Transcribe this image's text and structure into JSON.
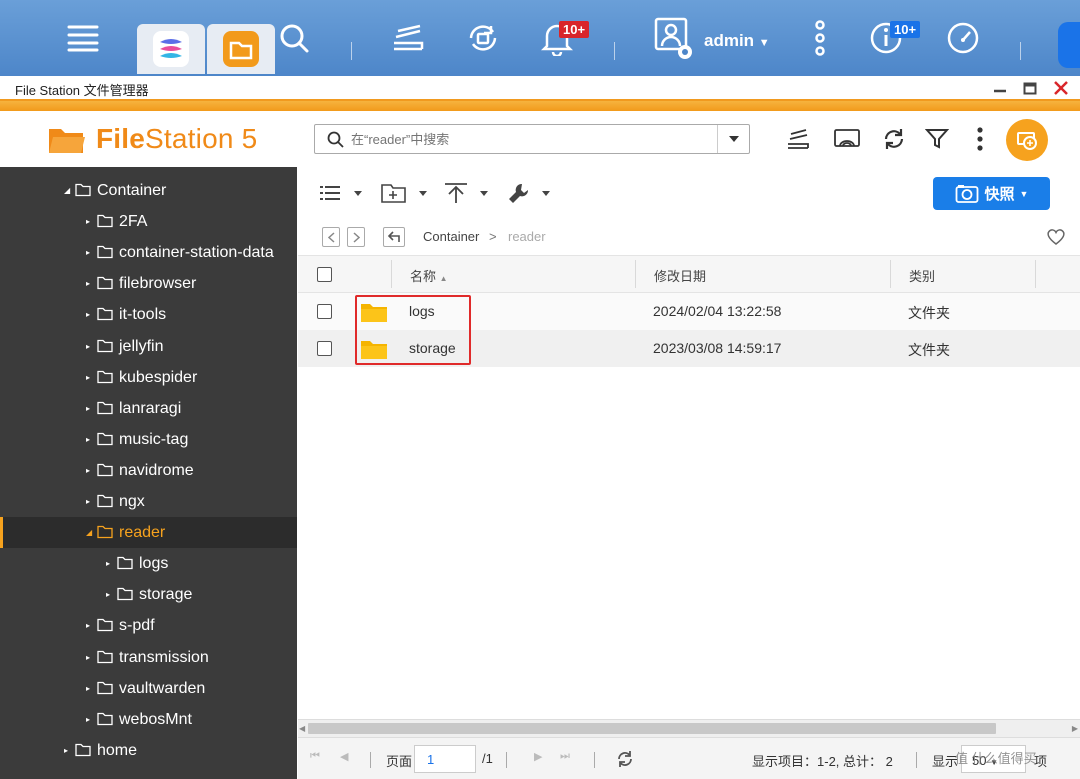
{
  "taskbar": {
    "notification_badge": "10+",
    "user_label": "admin",
    "resource_badge": "10+"
  },
  "window": {
    "title": "File Station 文件管理器"
  },
  "app": {
    "logo_bold": "File",
    "logo_rest": "Station 5",
    "search_placeholder": "在“reader”中搜索"
  },
  "tree": [
    {
      "label": "Container",
      "level": 1,
      "expanded": true
    },
    {
      "label": "2FA",
      "level": 2
    },
    {
      "label": "container-station-data",
      "level": 2
    },
    {
      "label": "filebrowser",
      "level": 2
    },
    {
      "label": "it-tools",
      "level": 2
    },
    {
      "label": "jellyfin",
      "level": 2
    },
    {
      "label": "kubespider",
      "level": 2
    },
    {
      "label": "lanraragi",
      "level": 2
    },
    {
      "label": "music-tag",
      "level": 2
    },
    {
      "label": "navidrome",
      "level": 2
    },
    {
      "label": "ngx",
      "level": 2
    },
    {
      "label": "reader",
      "level": 2,
      "active": true,
      "expanded": true
    },
    {
      "label": "logs",
      "level": 3
    },
    {
      "label": "storage",
      "level": 3
    },
    {
      "label": "s-pdf",
      "level": 2
    },
    {
      "label": "transmission",
      "level": 2
    },
    {
      "label": "vaultwarden",
      "level": 2
    },
    {
      "label": "webosMnt",
      "level": 2
    },
    {
      "label": "home",
      "level": 1
    }
  ],
  "toolbar": {
    "snapshot_label": "快照"
  },
  "breadcrumb": {
    "parent": "Container",
    "separator": ">",
    "current": "reader"
  },
  "table": {
    "columns": [
      "名称",
      "修改日期",
      "类别"
    ],
    "rows": [
      {
        "name": "logs",
        "modified": "2024/02/04 13:22:58",
        "type": "文件夹"
      },
      {
        "name": "storage",
        "modified": "2023/03/08 14:59:17",
        "type": "文件夹"
      }
    ]
  },
  "pager": {
    "page_label": "页面",
    "page_value": "1",
    "total_pages": "/1",
    "items_label": "显示项目：",
    "items_value": "1-2, 总计：",
    "items_total": "2",
    "show_label": "显示",
    "per_page": "50",
    "per_page_suffix": "项"
  },
  "watermark": "值 什么值得买",
  "colors": {
    "accent_orange": "#f08a18",
    "sidebar_bg": "#3b3b3b",
    "snapshot_blue": "#1a7ee8",
    "folder_yellow": "#f5b400",
    "highlight_red": "#e02a2a"
  }
}
